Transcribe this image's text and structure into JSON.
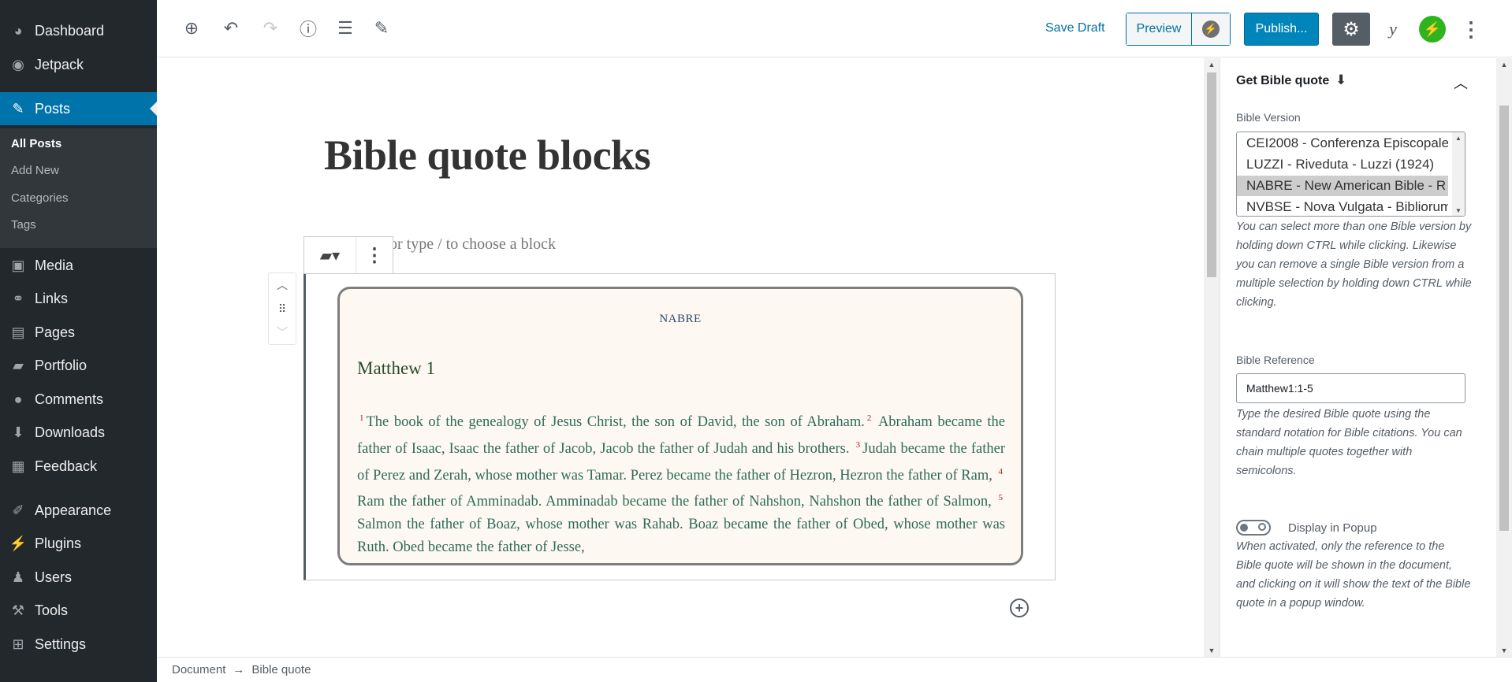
{
  "admin_menu": {
    "items": [
      {
        "label": "Dashboard",
        "icon": "dashboard-icon"
      },
      {
        "label": "Jetpack",
        "icon": "jetpack-icon"
      },
      {
        "label": "Posts",
        "icon": "pin-icon"
      },
      {
        "label": "Media",
        "icon": "media-icon"
      },
      {
        "label": "Links",
        "icon": "link-icon"
      },
      {
        "label": "Pages",
        "icon": "page-icon"
      },
      {
        "label": "Portfolio",
        "icon": "portfolio-icon"
      },
      {
        "label": "Comments",
        "icon": "comment-icon"
      },
      {
        "label": "Downloads",
        "icon": "download-icon"
      },
      {
        "label": "Feedback",
        "icon": "feedback-icon"
      },
      {
        "label": "Appearance",
        "icon": "appearance-icon"
      },
      {
        "label": "Plugins",
        "icon": "plugin-icon"
      },
      {
        "label": "Users",
        "icon": "user-icon"
      },
      {
        "label": "Tools",
        "icon": "wrench-icon"
      },
      {
        "label": "Settings",
        "icon": "settings-icon"
      }
    ],
    "posts_submenu": [
      "All Posts",
      "Add New",
      "Categories",
      "Tags"
    ],
    "active_item": "Posts",
    "current_submenu": "All Posts"
  },
  "toolbar": {
    "save_draft": "Save Draft",
    "preview": "Preview",
    "publish": "Publish..."
  },
  "post": {
    "title": "Bible quote blocks",
    "appender_hint": "g or type / to choose a block"
  },
  "bible_quote": {
    "version": "NABRE",
    "reference": "Matthew 1",
    "verses": [
      {
        "num": "1",
        "text": "The book of the genealogy of Jesus Christ, the son of David, the son of Abraham."
      },
      {
        "num": "2",
        "text": "Abraham became the father of Isaac, Isaac the father of Jacob, Jacob the father of Judah and his brothers."
      },
      {
        "num": "3",
        "text": "Judah became the father of Perez and Zerah, whose mother was Tamar. Perez became the father of Hezron, Hezron the father of Ram,"
      },
      {
        "num": "4",
        "text": "Ram the father of Amminadab. Amminadab became the father of Nahshon, Nahshon the father of Salmon,"
      },
      {
        "num": "5",
        "text": "Salmon the father of Boaz, whose mother was Rahab. Boaz became the father of Obed, whose mother was Ruth. Obed became the father of Jesse,"
      }
    ]
  },
  "settings_panel": {
    "title": "Get Bible quote",
    "version_label": "Bible Version",
    "version_options": [
      "CEI2008 - Conferenza Episcopale",
      "LUZZI - Riveduta - Luzzi (1924)",
      "NABRE - New American Bible - R",
      "NVBSE - Nova Vulgata - Bibliorum"
    ],
    "selected_version": "NABRE - New American Bible - R",
    "version_help": "You can select more than one Bible version by holding down CTRL while clicking. Likewise you can remove a single Bible version from a multiple selection by holding down CTRL while clicking.",
    "reference_label": "Bible Reference",
    "reference_value": "Matthew1:1-5",
    "reference_help": "Type the desired Bible quote using the standard notation for Bible citations. You can chain multiple quotes together with semicolons.",
    "popup_label": "Display in Popup",
    "popup_enabled": false,
    "popup_help": "When activated, only the reference to the Bible quote will be shown in the document, and clicking on it will show the text of the Bible quote in a popup window."
  },
  "breadcrumb": {
    "items": [
      "Document",
      "Bible quote"
    ],
    "separator": "→"
  },
  "colors": {
    "admin_bg": "#23282d",
    "accent": "#0073aa",
    "publish": "#0085ba",
    "quote_bg": "#fdf8f1",
    "verse_num": "#b02323"
  }
}
